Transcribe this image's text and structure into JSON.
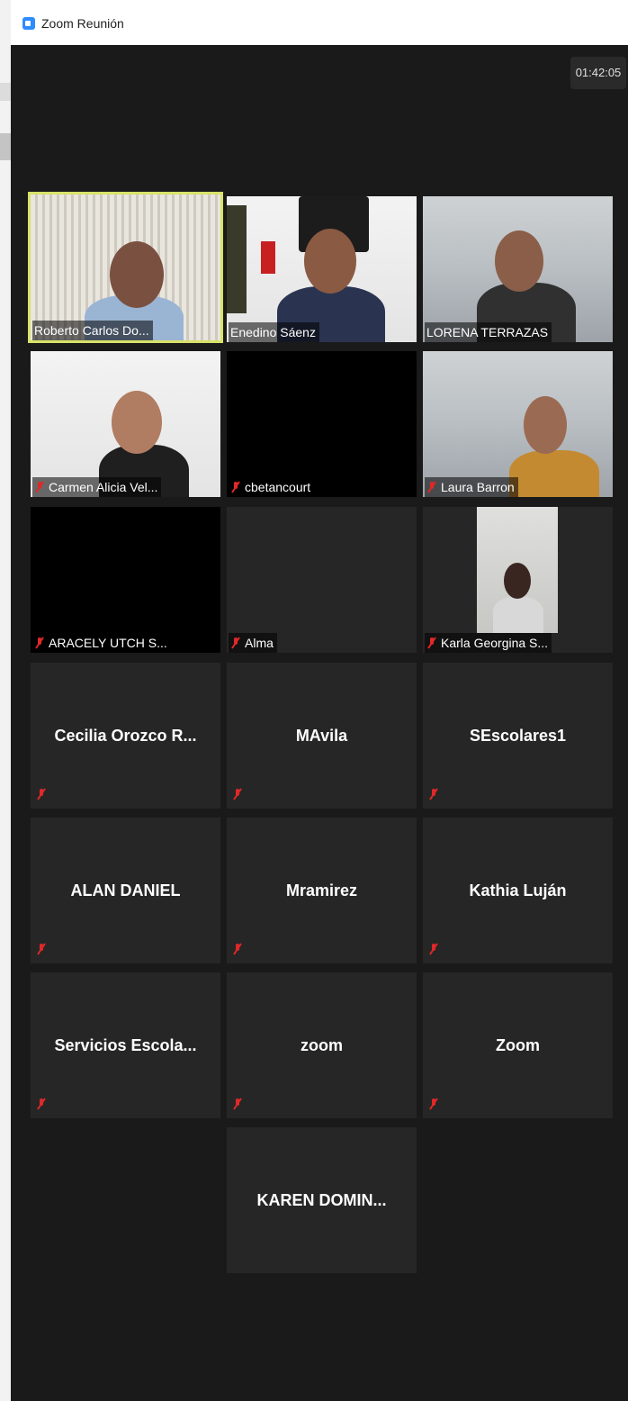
{
  "window": {
    "title": "Zoom Reunión"
  },
  "meeting": {
    "timer": "01:42:05"
  },
  "participants": [
    {
      "name": "Roberto Carlos Do...",
      "video": true,
      "muted": false,
      "active_speaker": true
    },
    {
      "name": "Enedino Sáenz",
      "video": true,
      "muted": false
    },
    {
      "name": "LORENA TERRAZAS",
      "video": true,
      "muted": false
    },
    {
      "name": "Carmen Alicia Vel...",
      "video": true,
      "muted": true
    },
    {
      "name": "cbetancourt",
      "video": false,
      "muted": true
    },
    {
      "name": "Laura Barron",
      "video": true,
      "muted": true
    },
    {
      "name": "ARACELY UTCH S...",
      "video": false,
      "muted": true
    },
    {
      "name": "Alma",
      "video": false,
      "muted": true
    },
    {
      "name": "Karla Georgina S...",
      "video": true,
      "muted": true
    },
    {
      "name": "Cecilia  Orozco  R...",
      "video": false,
      "muted": true
    },
    {
      "name": "MAvila",
      "video": false,
      "muted": true
    },
    {
      "name": "SEscolares1",
      "video": false,
      "muted": true
    },
    {
      "name": "ALAN DANIEL",
      "video": false,
      "muted": true
    },
    {
      "name": "Mramirez",
      "video": false,
      "muted": true
    },
    {
      "name": "Kathia Luján",
      "video": false,
      "muted": true
    },
    {
      "name": "Servicios  Escola...",
      "video": false,
      "muted": true
    },
    {
      "name": "zoom",
      "video": false,
      "muted": true
    },
    {
      "name": "Zoom",
      "video": false,
      "muted": true
    },
    {
      "name": "KAREN  DOMIN...",
      "video": false,
      "muted": false
    }
  ],
  "icons": {
    "muted_mic": "muted-mic-icon",
    "app_logo": "zoom-logo-icon"
  },
  "colors": {
    "active_speaker_border": "#d9e26a",
    "muted_icon": "#e02828",
    "tile_bg": "#262626",
    "window_bg": "#1a1a1a"
  }
}
